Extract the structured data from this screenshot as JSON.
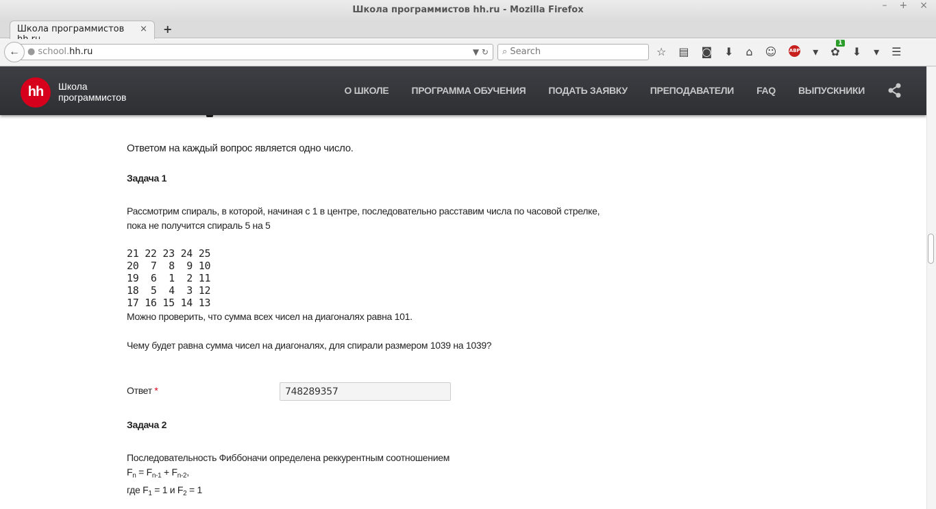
{
  "window": {
    "title": "Школа программистов hh.ru - Mozilla Firefox",
    "controls": [
      "–",
      "+",
      "×"
    ]
  },
  "tabs": [
    {
      "label": "Школа программистов hh.ru",
      "close": "×"
    }
  ],
  "newtab_label": "+",
  "toolbar": {
    "url_prefix": "school.",
    "url_host": "hh.ru",
    "search_placeholder": "Search",
    "addon_badge": "1"
  },
  "site": {
    "logo_text": "hh",
    "brand_line1": "Школа",
    "brand_line2": "программистов",
    "brand_color": "#d6001c",
    "nav": [
      "О ШКОЛЕ",
      "ПРОГРАММА ОБУЧЕНИЯ",
      "ПОДАТЬ ЗАЯВКУ",
      "ПРЕПОДАВАТЕЛИ",
      "FAQ",
      "ВЫПУСКНИКИ"
    ]
  },
  "content": {
    "intro": "Ответом на каждый вопрос является одно число.",
    "task1_title": "Задача 1",
    "task1_line1": "Рассмотрим спираль, в которой, начиная с 1 в центре, последовательно расставим числа по часовой стрелке,",
    "task1_line2": "пока не получится спираль 5 на 5",
    "spiral_rows": [
      "21 22 23 24 25",
      "20  7  8  9 10",
      "19  6  1  2 11",
      "18  5  4  3 12",
      "17 16 15 14 13"
    ],
    "task1_check": "Можно проверить, что сумма всех чисел на диагоналях равна 101.",
    "task1_question": "Чему будет равна сумма чисел на диагоналях, для спирали размером 1039 на 1039?",
    "answer_label": "Ответ",
    "answer_required": "*",
    "answer_value": "748289357",
    "task2_title": "Задача 2",
    "task2_line1": "Последовательность Фиббоначи определена реккурентным соотношением"
  }
}
